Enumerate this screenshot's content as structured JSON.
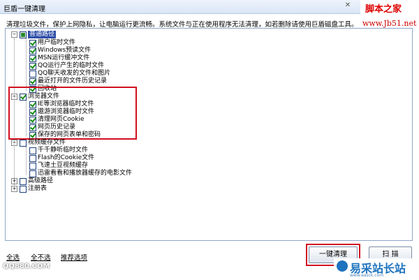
{
  "window": {
    "title": "巨盾一键清理"
  },
  "watermark_top": {
    "line1": "脚本之家",
    "line2": "www.Jb51.net"
  },
  "description": "清理垃圾文件，保护上网隐私，让电脑运行更流畅。系统文件与正在使用程序无法清理，如若删除请使用巨盾磁盘工具。",
  "tree": {
    "common": {
      "label": "普通路径",
      "items": [
        {
          "label": "用户临时文件",
          "checked": true
        },
        {
          "label": "Windows预读文件",
          "checked": true
        },
        {
          "label": "MSN运行缓冲文件",
          "checked": true
        },
        {
          "label": "QQ运行产生的临时文件",
          "checked": true
        },
        {
          "label": "QQ聊天收发的文件和图片",
          "checked": false
        },
        {
          "label": "最近打开的文件历史记录",
          "checked": true
        },
        {
          "label": "回收站",
          "checked": true
        }
      ]
    },
    "browser": {
      "label": "浏览器文件",
      "items": [
        {
          "label": "IE等浏览器临时文件",
          "checked": true
        },
        {
          "label": "遨游浏览器临时文件",
          "checked": true
        },
        {
          "label": "清理网页Cookie",
          "checked": true
        },
        {
          "label": "网页历史记录",
          "checked": true
        },
        {
          "label": "保存的网页表单和密码",
          "checked": true
        }
      ]
    },
    "video": {
      "label": "视频缓存文件",
      "items": [
        {
          "label": "千千静听临时文件",
          "checked": false
        },
        {
          "label": "Flash的Cookie文件",
          "checked": false
        },
        {
          "label": "飞速土豆视频缓存",
          "checked": false
        },
        {
          "label": "迅雷看看和播放器缓存的电影文件",
          "checked": false
        }
      ]
    },
    "advanced": {
      "label": "高级路径"
    },
    "registry": {
      "label": "注册表"
    }
  },
  "footer": {
    "select_all": "全选",
    "select_none": "全不选",
    "recommended": "推荐选项",
    "clean_button": "一键清理",
    "scan_button": "扫 描"
  },
  "watermark_bottom": {
    "left": "QQ880.COM",
    "right": "易采站长站",
    "url": "www.easck.com"
  },
  "colors": {
    "highlight_border": "#d01020",
    "selection": "#2f4fa8"
  }
}
